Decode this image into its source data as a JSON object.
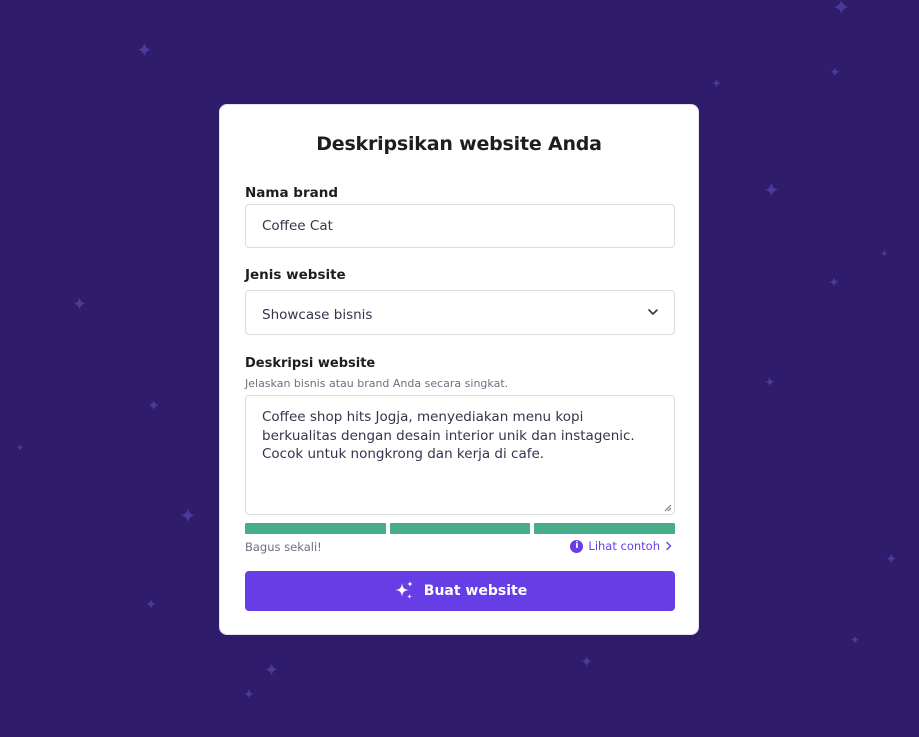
{
  "form": {
    "title": "Deskripsikan website Anda",
    "brand": {
      "label": "Nama brand",
      "value": "Coffee Cat"
    },
    "type": {
      "label": "Jenis website",
      "value": "Showcase bisnis"
    },
    "description": {
      "label": "Deskripsi website",
      "hint": "Jelaskan bisnis atau brand Anda secara singkat.",
      "value": "Coffee shop hits Jogja, menyediakan menu kopi berkualitas dengan desain interior unik dan instagenic. Cocok untuk nongkrong dan kerja di cafe."
    },
    "quality": {
      "status": "Bagus sekali!",
      "filled_segments": 3,
      "total_segments": 3,
      "example_link": "Lihat contoh"
    },
    "submit_label": "Buat website"
  },
  "colors": {
    "background": "#2f1c6a",
    "accent": "#673de6",
    "meter": "#48ad8b"
  },
  "icons": [
    "chevron-down-icon",
    "info-icon",
    "chevron-right-icon",
    "sparkle-icon"
  ]
}
